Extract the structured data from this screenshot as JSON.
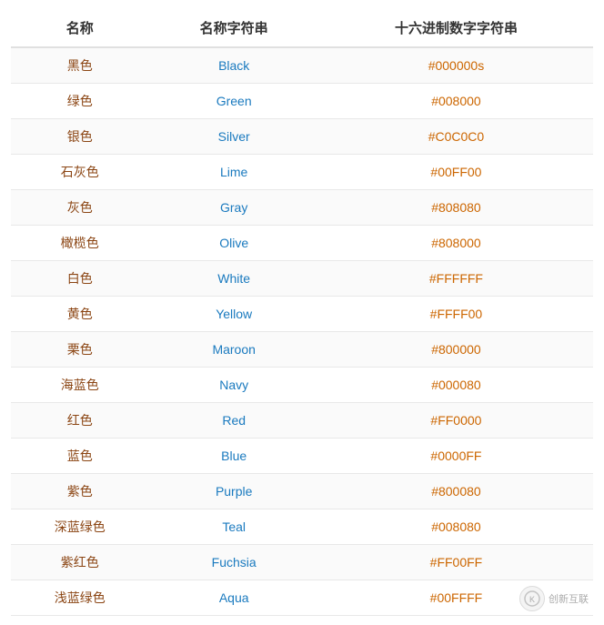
{
  "table": {
    "headers": [
      "名称",
      "名称字符串",
      "十六进制数字字符串"
    ],
    "rows": [
      {
        "name": "黑色",
        "nameStr": "Black",
        "hex": "#000000s"
      },
      {
        "name": "绿色",
        "nameStr": "Green",
        "hex": "#008000"
      },
      {
        "name": "银色",
        "nameStr": "Silver",
        "hex": "#C0C0C0"
      },
      {
        "name": "石灰色",
        "nameStr": "Lime",
        "hex": "#00FF00"
      },
      {
        "name": "灰色",
        "nameStr": "Gray",
        "hex": "#808080"
      },
      {
        "name": "橄榄色",
        "nameStr": "Olive",
        "hex": "#808000"
      },
      {
        "name": "白色",
        "nameStr": "White",
        "hex": "#FFFFFF"
      },
      {
        "name": "黄色",
        "nameStr": "Yellow",
        "hex": "#FFFF00"
      },
      {
        "name": "栗色",
        "nameStr": "Maroon",
        "hex": "#800000"
      },
      {
        "name": "海蓝色",
        "nameStr": "Navy",
        "hex": "#000080"
      },
      {
        "name": "红色",
        "nameStr": "Red",
        "hex": "#FF0000"
      },
      {
        "name": "蓝色",
        "nameStr": "Blue",
        "hex": "#0000FF"
      },
      {
        "name": "紫色",
        "nameStr": "Purple",
        "hex": "#800080"
      },
      {
        "name": "深蓝绿色",
        "nameStr": "Teal",
        "hex": "#008080"
      },
      {
        "name": "紫红色",
        "nameStr": "Fuchsia",
        "hex": "#FF00FF"
      },
      {
        "name": "浅蓝绿色",
        "nameStr": "Aqua",
        "hex": "#00FFFF"
      }
    ]
  },
  "watermark": {
    "iconText": "K",
    "text": "创新互联"
  }
}
